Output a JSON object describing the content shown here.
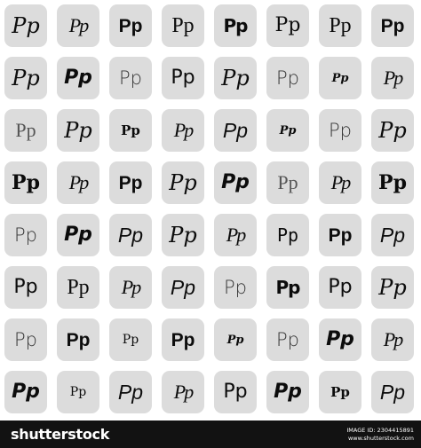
{
  "tiles": [
    {
      "text": "Pp",
      "style": "s-ital-serif"
    },
    {
      "text": "Pp",
      "style": "s-script"
    },
    {
      "text": "Pp",
      "style": "s-bold-sans"
    },
    {
      "text": "Pp",
      "style": "s-serif"
    },
    {
      "text": "Pp",
      "style": "s-stencil"
    },
    {
      "text": "Pp",
      "style": "s-serif-lg"
    },
    {
      "text": "Pp",
      "style": "s-serif"
    },
    {
      "text": "Pp",
      "style": "s-bold-sans"
    },
    {
      "text": "Pp",
      "style": "s-ital-serif"
    },
    {
      "text": "Pp",
      "style": "s-heavy-ital"
    },
    {
      "text": "Pp",
      "style": "s-thin-sans"
    },
    {
      "text": "Pp",
      "style": "s-sans"
    },
    {
      "text": "Pp",
      "style": "s-ital-serif"
    },
    {
      "text": "Pp",
      "style": "s-thin-sans"
    },
    {
      "text": "Pp",
      "style": "s-tiny-bold"
    },
    {
      "text": "Pp",
      "style": "s-script"
    },
    {
      "text": "Pp",
      "style": "s-thin-serif"
    },
    {
      "text": "Pp",
      "style": "s-ital-serif"
    },
    {
      "text": "Pp",
      "style": "s-small-bold"
    },
    {
      "text": "Pp",
      "style": "s-script"
    },
    {
      "text": "Pp",
      "style": "s-ital-sans"
    },
    {
      "text": "Pp",
      "style": "s-tiny-bold"
    },
    {
      "text": "Pp",
      "style": "s-thin-sans"
    },
    {
      "text": "Pp",
      "style": "s-ital-serif"
    },
    {
      "text": "Pp",
      "style": "s-bold-serif"
    },
    {
      "text": "Pp",
      "style": "s-script"
    },
    {
      "text": "Pp",
      "style": "s-bold-sans"
    },
    {
      "text": "Pp",
      "style": "s-ital-serif"
    },
    {
      "text": "Pp",
      "style": "s-heavy-ital"
    },
    {
      "text": "Pp",
      "style": "s-thin-serif"
    },
    {
      "text": "Pp",
      "style": "s-script"
    },
    {
      "text": "Pp",
      "style": "s-bold-serif"
    },
    {
      "text": "Pp",
      "style": "s-thin-sans"
    },
    {
      "text": "Pp",
      "style": "s-heavy-ital"
    },
    {
      "text": "Pp",
      "style": "s-ital-sans"
    },
    {
      "text": "Pp",
      "style": "s-ital-serif"
    },
    {
      "text": "Pp",
      "style": "s-script"
    },
    {
      "text": "Pp",
      "style": "s-mono"
    },
    {
      "text": "Pp",
      "style": "s-bold-sans"
    },
    {
      "text": "Pp",
      "style": "s-ital-sans"
    },
    {
      "text": "Pp",
      "style": "s-sans"
    },
    {
      "text": "Pp",
      "style": "s-serif"
    },
    {
      "text": "Pp",
      "style": "s-script"
    },
    {
      "text": "Pp",
      "style": "s-ital-sans"
    },
    {
      "text": "Pp",
      "style": "s-thin-sans"
    },
    {
      "text": "Pp",
      "style": "s-stencil"
    },
    {
      "text": "Pp",
      "style": "s-sans"
    },
    {
      "text": "Pp",
      "style": "s-ital-serif"
    },
    {
      "text": "Pp",
      "style": "s-thin-sans"
    },
    {
      "text": "Pp",
      "style": "s-bold-sans"
    },
    {
      "text": "Pp",
      "style": "s-small-serif"
    },
    {
      "text": "Pp",
      "style": "s-bold-sans"
    },
    {
      "text": "Pp",
      "style": "s-tiny-bold"
    },
    {
      "text": "Pp",
      "style": "s-thin-sans"
    },
    {
      "text": "Pp",
      "style": "s-heavy-ital"
    },
    {
      "text": "Pp",
      "style": "s-script"
    },
    {
      "text": "Pp",
      "style": "s-heavy-ital"
    },
    {
      "text": "Pp",
      "style": "s-small-serif"
    },
    {
      "text": "Pp",
      "style": "s-ital-sans"
    },
    {
      "text": "Pp",
      "style": "s-script"
    },
    {
      "text": "Pp",
      "style": "s-sans"
    },
    {
      "text": "Pp",
      "style": "s-heavy-ital"
    },
    {
      "text": "Pp",
      "style": "s-small-bold"
    },
    {
      "text": "Pp",
      "style": "s-ital-sans"
    }
  ],
  "footer": {
    "brand": "shutterstock",
    "image_id": "IMAGE ID: 2304415891",
    "site": "www.shutterstock.com"
  },
  "colors": {
    "tile_bg": "#dcdcdc",
    "glyph": "#0c0c0c",
    "footer_bg": "#121212",
    "footer_text": "#ffffff"
  }
}
